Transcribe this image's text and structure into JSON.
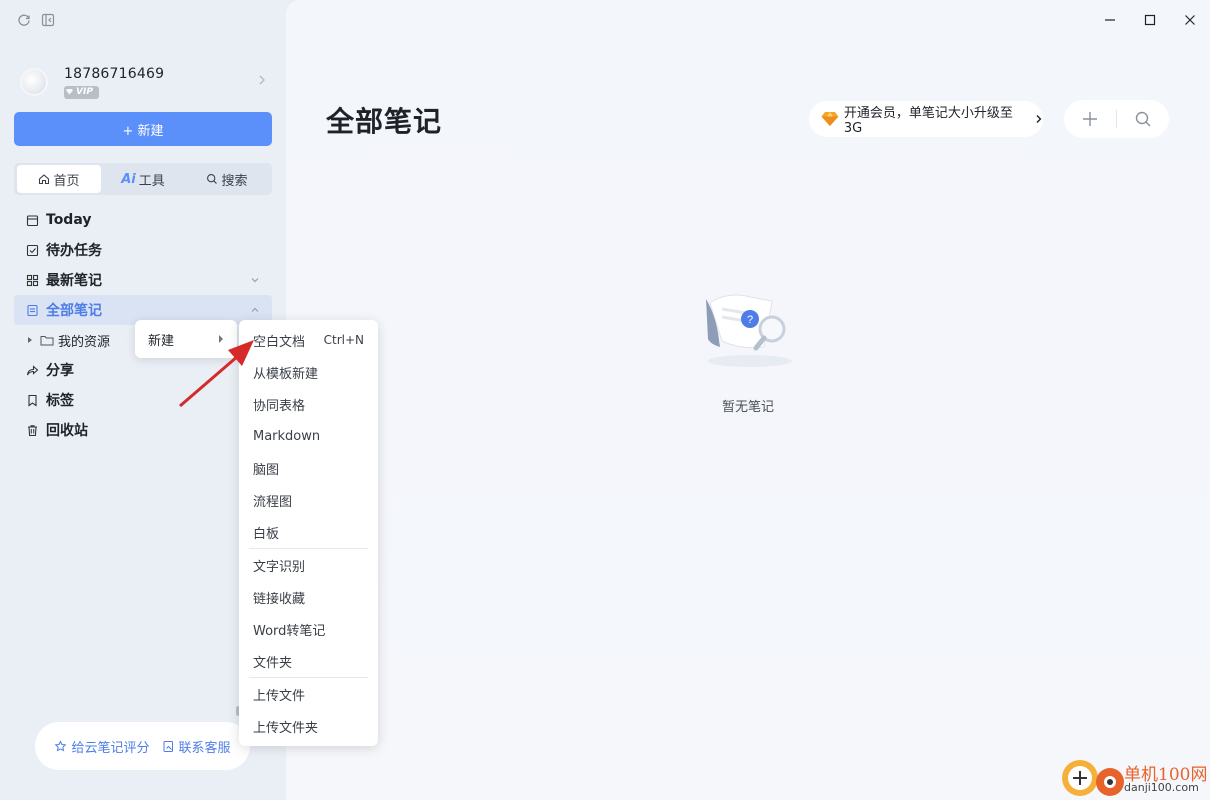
{
  "sidebar": {
    "user": {
      "phone": "18786716469",
      "badge": "VIP"
    },
    "new_button": "+ 新建",
    "tabs": [
      {
        "label": "首页",
        "active": true
      },
      {
        "label": "工具",
        "prefix": "Ai",
        "active": false
      },
      {
        "label": "搜索",
        "active": false
      }
    ],
    "nav": {
      "today": "Today",
      "todo": "待办任务",
      "recent": "最新笔记",
      "all_notes": "全部笔记",
      "my_resources": "我的资源",
      "share": "分享",
      "tags": "标签",
      "trash": "回收站"
    },
    "footer": {
      "rate": "给云笔记评分",
      "support": "联系客服"
    }
  },
  "main": {
    "title": "全部笔记",
    "promo": "开通会员，单笔记大小升级至3G",
    "empty_text": "暂无笔记"
  },
  "context_menu": {
    "parent_label": "新建",
    "items": [
      {
        "label": "空白文档",
        "shortcut": "Ctrl+N"
      },
      {
        "label": "从模板新建"
      },
      {
        "label": "协同表格"
      },
      {
        "label": "Markdown"
      },
      {
        "label": "脑图"
      },
      {
        "label": "流程图"
      },
      {
        "label": "白板"
      },
      {
        "label": "文字识别"
      },
      {
        "label": "链接收藏"
      },
      {
        "label": "Word转笔记"
      },
      {
        "label": "文件夹"
      },
      {
        "label": "上传文件"
      },
      {
        "label": "上传文件夹"
      }
    ]
  },
  "watermark": {
    "title": "单机100网",
    "url": "danji100.com"
  },
  "colors": {
    "accent": "#5b8ff9",
    "selected_bg": "#d9e3f4",
    "arrow": "#d42a2a",
    "watermark": "#e8632b"
  }
}
